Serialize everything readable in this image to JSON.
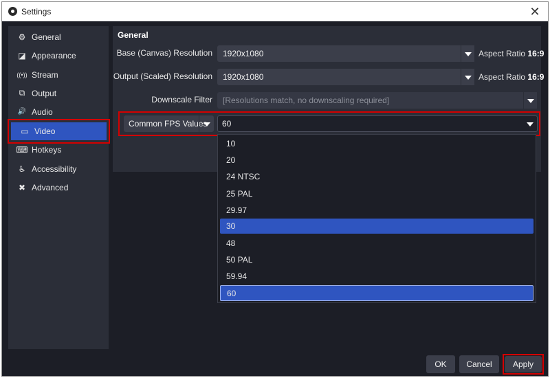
{
  "window": {
    "title": "Settings",
    "close_glyph": "✕"
  },
  "sidebar": {
    "items": [
      {
        "label": "General",
        "icon": "gear-icon",
        "glyph": "⚙"
      },
      {
        "label": "Appearance",
        "icon": "appearance-icon",
        "glyph": "◪"
      },
      {
        "label": "Stream",
        "icon": "stream-icon",
        "glyph": "((•))"
      },
      {
        "label": "Output",
        "icon": "output-icon",
        "glyph": "⧉"
      },
      {
        "label": "Audio",
        "icon": "speaker-icon",
        "glyph": "🔊"
      },
      {
        "label": "Video",
        "icon": "monitor-icon",
        "glyph": "▭"
      },
      {
        "label": "Hotkeys",
        "icon": "keyboard-icon",
        "glyph": "⌨"
      },
      {
        "label": "Accessibility",
        "icon": "accessibility-icon",
        "glyph": "♿"
      },
      {
        "label": "Advanced",
        "icon": "tools-icon",
        "glyph": "✖"
      }
    ],
    "active": "Video"
  },
  "general": {
    "title": "General",
    "base_label": "Base (Canvas) Resolution",
    "base_value": "1920x1080",
    "base_aspect_prefix": "Aspect Ratio",
    "base_aspect_value": "16:9",
    "output_label": "Output (Scaled) Resolution",
    "output_value": "1920x1080",
    "output_aspect_prefix": "Aspect Ratio",
    "output_aspect_value": "16:9",
    "downscale_label": "Downscale Filter",
    "downscale_value": "[Resolutions match, no downscaling required]",
    "fps_type": "Common FPS Values",
    "fps_value": "60"
  },
  "fps_dropdown": {
    "options": [
      "10",
      "20",
      "24 NTSC",
      "25 PAL",
      "29.97",
      "30",
      "48",
      "50 PAL",
      "59.94",
      "60"
    ],
    "hovered": "30",
    "selected": "60"
  },
  "footer": {
    "ok": "OK",
    "cancel": "Cancel",
    "apply": "Apply"
  },
  "colors": {
    "accent": "#2f55c0",
    "highlight_border": "#d40000",
    "panel": "#2b2e38",
    "background": "#1c1e26"
  }
}
